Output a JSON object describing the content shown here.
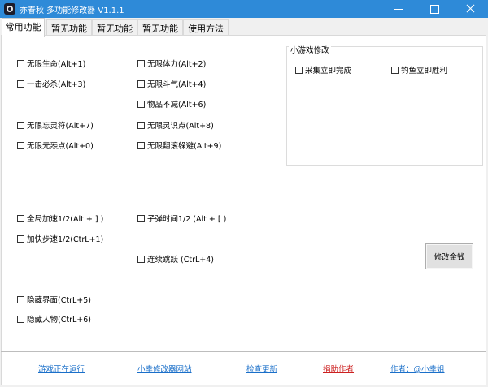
{
  "window": {
    "title": "亦春秋 多功能修改器  V1.1.1",
    "colors": {
      "titlebar": "#2e8ad8"
    }
  },
  "tabs": [
    "常用功能",
    "暂无功能",
    "暂无功能",
    "暂无功能",
    "使用方法"
  ],
  "checkboxes": {
    "c1": "无限生命(Alt+1)",
    "c2": "无限体力(Alt+2)",
    "c3": "一击必杀(Alt+3)",
    "c4": "无限斗气(Alt+4)",
    "c5": "物品不减(Alt+6)",
    "c6": "无限忘灵符(Alt+7)",
    "c7": "无限灵识点(Alt+8)",
    "c8": "无限元炁点(Alt+0)",
    "c9": "无限翻滚躲避(Alt+9)",
    "c10": "全局加速1/2(Alt + ] )",
    "c11": "子弹时间1/2 (Alt + [ )",
    "c12": "加快步速1/2(CtrL+1)",
    "c13": "连续跳跃 (CtrL+4)",
    "c14": "隐藏界面(CtrL+5)",
    "c15": "隐藏人物(CtrL+6)"
  },
  "minigame": {
    "title": "小游戏修改",
    "option1": "采集立即完成",
    "option2": "钓鱼立即胜利"
  },
  "money_button": "修改金钱",
  "footer": {
    "status": "游戏正在运行",
    "site": "小幸修改器网站",
    "update": "检查更新",
    "donate": "捐助作者",
    "author": "作者：@小幸姐",
    "colors": {
      "link": "#1a6fc9",
      "donate": "#cc2020"
    }
  }
}
